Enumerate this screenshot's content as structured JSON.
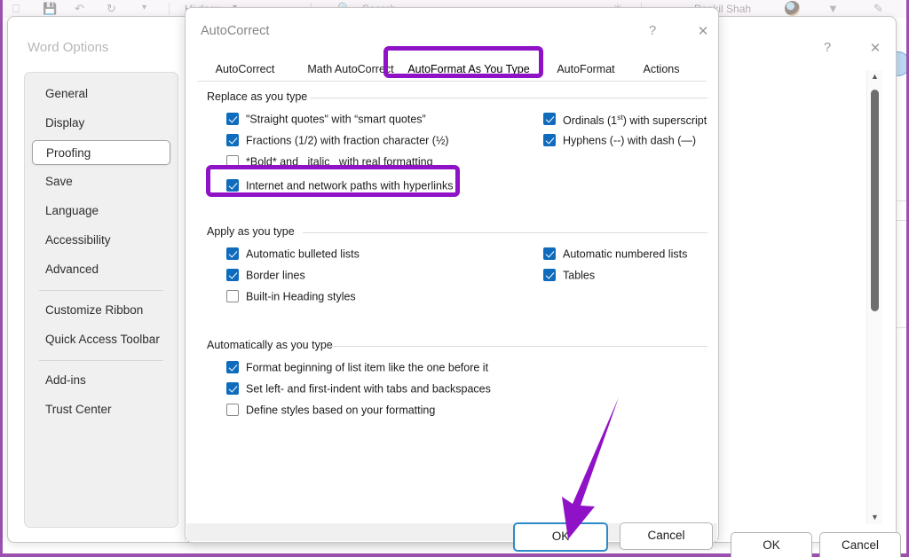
{
  "word_app": {
    "filename": "Hi.docx",
    "search_placeholder": "Search",
    "user_name": "Pankil Shah",
    "icons": [
      "save-icon",
      "undo-icon",
      "redo-icon",
      "customize-quick-access-icon",
      "search-icon",
      "comments-icon",
      "share-icon",
      "editing-icon"
    ]
  },
  "word_options": {
    "title": "Word Options",
    "help_label": "?",
    "close_label": "✕",
    "nav_items": [
      {
        "label": "General",
        "selected": false
      },
      {
        "label": "Display",
        "selected": false
      },
      {
        "label": "Proofing",
        "selected": true
      },
      {
        "label": "Save",
        "selected": false
      },
      {
        "label": "Language",
        "selected": false
      },
      {
        "label": "Accessibility",
        "selected": false
      },
      {
        "label": "Advanced",
        "selected": false
      },
      {
        "label": "Customize Ribbon",
        "selected": false
      },
      {
        "label": "Quick Access Toolbar",
        "selected": false
      },
      {
        "label": "Add-ins",
        "selected": false
      },
      {
        "label": "Trust Center",
        "selected": false
      }
    ],
    "ok_label": "OK",
    "cancel_label": "Cancel",
    "scrollbar": {
      "up_arrow": "▲",
      "down_arrow": "▼"
    }
  },
  "autocorrect": {
    "title": "AutoCorrect",
    "help_label": "?",
    "close_label": "✕",
    "tabs": [
      {
        "label": "AutoCorrect",
        "active": false
      },
      {
        "label": "Math AutoCorrect",
        "active": false
      },
      {
        "label": "AutoFormat As You Type",
        "active": true
      },
      {
        "label": "AutoFormat",
        "active": false
      },
      {
        "label": "Actions",
        "active": false
      }
    ],
    "groups": [
      {
        "label": "Replace as you type",
        "left_items": [
          {
            "label": "\"Straight quotes\" with “smart quotes”",
            "checked": true
          },
          {
            "label": "Fractions (1/2) with fraction character (½)",
            "checked": true
          },
          {
            "label": "*Bold* and _italic_ with real formatting",
            "checked": false
          },
          {
            "label": "Internet and network paths with hyperlinks",
            "checked": true
          }
        ],
        "right_items": [
          {
            "label": "Ordinals (1st) with superscript",
            "checked": true,
            "superscript": "st",
            "prefix": "Ordinals (1",
            "suffix": ") with superscript"
          },
          {
            "label": "Hyphens (--) with dash (—)",
            "checked": true
          }
        ]
      },
      {
        "label": "Apply as you type",
        "left_items": [
          {
            "label": "Automatic bulleted lists",
            "checked": true
          },
          {
            "label": "Border lines",
            "checked": true
          },
          {
            "label": "Built-in Heading styles",
            "checked": false
          }
        ],
        "right_items": [
          {
            "label": "Automatic numbered lists",
            "checked": true
          },
          {
            "label": "Tables",
            "checked": true
          }
        ]
      },
      {
        "label": "Automatically as you type",
        "left_items": [
          {
            "label": "Format beginning of list item like the one before it",
            "checked": true
          },
          {
            "label": "Set left- and first-indent with tabs and backspaces",
            "checked": true
          },
          {
            "label": "Define styles based on your formatting",
            "checked": false
          }
        ],
        "right_items": []
      }
    ],
    "ok_label": "OK",
    "cancel_label": "Cancel"
  },
  "annotations": {
    "highlight_color": "#9012c6",
    "highlight_tab": "AutoFormat As You Type",
    "highlight_checkbox": "Internet and network paths with hyperlinks",
    "arrow_target": "OK"
  }
}
